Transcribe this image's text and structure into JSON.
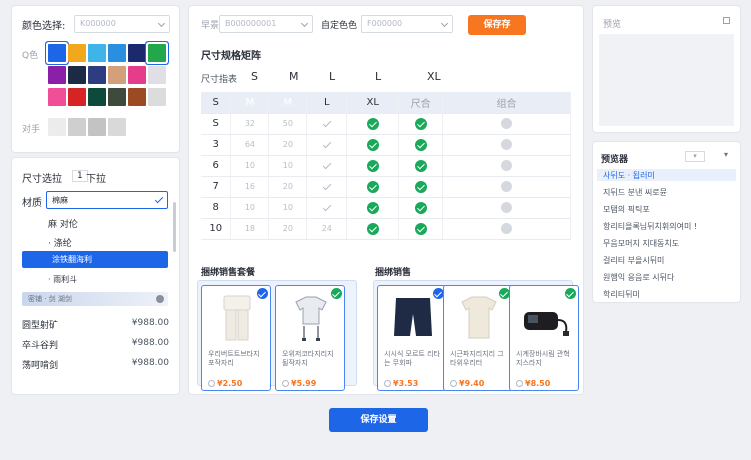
{
  "left_top": {
    "color_select_label": "颜色选择:",
    "color_select_placeholder": "K000000",
    "swatch_label": "Q色",
    "contrast_label": "对手"
  },
  "swatches": [
    {
      "color": "#1e66e8",
      "selected": true
    },
    {
      "color": "#f2a81d",
      "selected": false
    },
    {
      "color": "#3fb4e8",
      "selected": false
    },
    {
      "color": "#2a8fde",
      "selected": false
    },
    {
      "color": "#1b2a6e",
      "selected": false
    },
    {
      "color": "#22a84a",
      "selected": true
    },
    {
      "color": "#8a1fa8",
      "selected": false
    },
    {
      "color": "#1c2a44",
      "selected": false
    },
    {
      "color": "#2c3e80",
      "selected": false
    },
    {
      "color": "#d4a07a",
      "selected": false
    },
    {
      "color": "#e63d8a",
      "selected": false
    },
    {
      "color": "#e1dfe6",
      "selected": false
    },
    {
      "color": "#f04f97",
      "selected": false
    },
    {
      "color": "#d62424",
      "selected": false
    },
    {
      "color": "#0e4a3a",
      "selected": false
    },
    {
      "color": "#3d4a3c",
      "selected": false
    },
    {
      "color": "#9c4a24",
      "selected": false
    },
    {
      "color": "#dcdcdc",
      "selected": false
    }
  ],
  "contrast_swatches": [
    "#ececec",
    "#cfcfcf",
    "#c3c3c3",
    "#d9d9d9"
  ],
  "left_bottom": {
    "size_title": "尺寸选拉",
    "size_count": "1",
    "size_pull": "下拉",
    "material_label": "材质",
    "material_value": "棉麻",
    "options": [
      "麻 对伦",
      "· 涤纶",
      "涂铁翻海利",
      "· 雨利斗"
    ],
    "slider_text": "密铺 · 剑 湖剑",
    "prices": [
      {
        "label": "圆型射矿",
        "value": "¥988.00"
      },
      {
        "label": "卒斗谷判",
        "value": "¥988.00"
      },
      {
        "label": "荡呵啃剑",
        "value": "¥988.00"
      }
    ]
  },
  "center": {
    "pattern_label": "早景",
    "pattern_placeholder": "B000000001",
    "custom_color_label": "自定色色",
    "custom_color_placeholder": "F000000",
    "save_button": "保存存",
    "matrix_title": "尺寸规格矩阵",
    "size_header_label": "尺寸指表",
    "size_header": [
      "S",
      "M",
      "L",
      "L",
      "XL"
    ],
    "matrix_columns": [
      "S",
      "M",
      "M",
      "L",
      "XL",
      "尺合",
      "组合"
    ],
    "matrix_rows": [
      {
        "size": "S",
        "a": "32",
        "b": "50",
        "c": "tick",
        "d": "green",
        "e": "green",
        "f": "gray"
      },
      {
        "size": "3",
        "a": "64",
        "b": "20",
        "c": "tick",
        "d": "green",
        "e": "green",
        "f": "gray"
      },
      {
        "size": "6",
        "a": "10",
        "b": "10",
        "c": "tick",
        "d": "green",
        "e": "green",
        "f": "gray"
      },
      {
        "size": "7",
        "a": "16",
        "b": "20",
        "c": "tick",
        "d": "green",
        "e": "green",
        "f": "gray"
      },
      {
        "size": "8",
        "a": "10",
        "b": "10",
        "c": "tick",
        "d": "green",
        "e": "green",
        "f": "gray"
      },
      {
        "size": "10",
        "a": "18",
        "b": "20",
        "c": "24",
        "d": "green",
        "e": "green",
        "f": "gray"
      }
    ],
    "bundle_title": "捆绑销售套餐",
    "bundle_title_2": "捆绑销售",
    "cards": [
      {
        "name": "우리버트트브타지 포작자리",
        "price": "¥2.50",
        "badge": "#1e66e8",
        "img": "pants"
      },
      {
        "name": "오위저코타지리지 될작자지",
        "price": "¥5.99",
        "badge": "#1aa85a",
        "img": "shirt"
      },
      {
        "name": "시시식 모르트 리타는 무회파",
        "price": "¥3.53",
        "badge": "#1e66e8",
        "img": "shorts"
      },
      {
        "name": "시근파지리지리 그타위우리터",
        "price": "¥9.40",
        "badge": "#1aa85a",
        "img": "tee"
      },
      {
        "name": "시계장바시림 관혁지스라지",
        "price": "¥8.50",
        "badge": "#1aa85a",
        "img": "device"
      }
    ],
    "save_settings": "保存设置"
  },
  "right_top": {
    "title": "预览"
  },
  "right_bottom": {
    "title": "预览器",
    "items": [
      "사뒤도 · 됩러미",
      "지뒤드 분낸 씨로뮨",
      "모탬의 픽틱포",
      "항리티을록님뒤치휘의여미 !",
      "무음모머지 지대동치도",
      "걸리티 부을시뒤미",
      "원햄익 응음로 시뒤다",
      "학리티뒤미"
    ]
  }
}
